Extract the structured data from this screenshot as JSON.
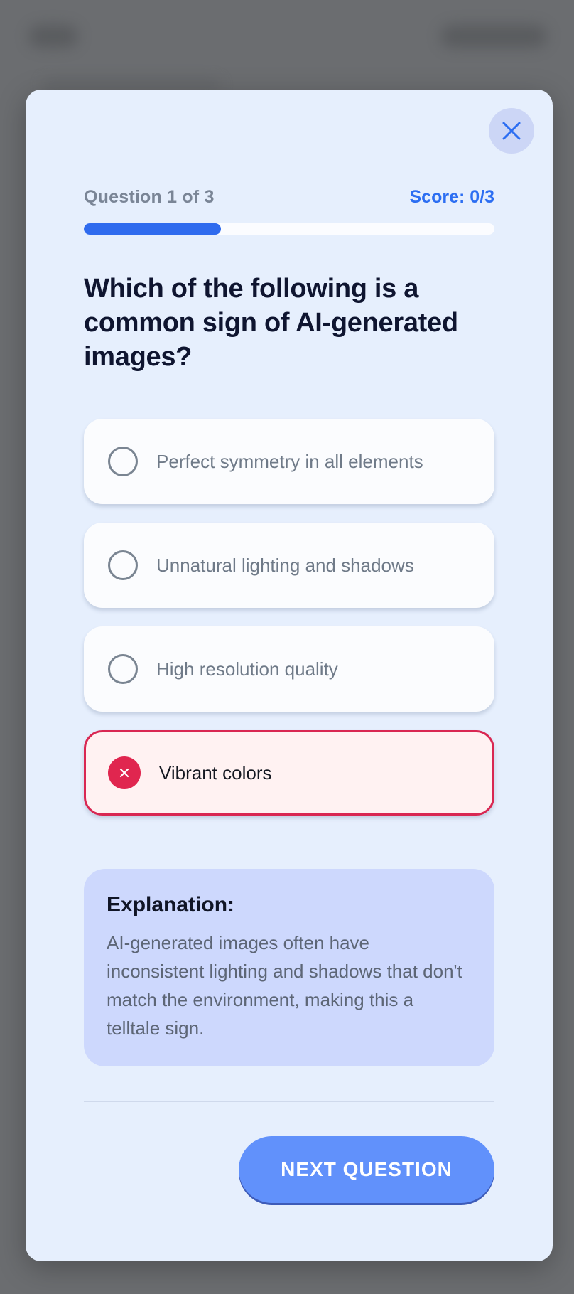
{
  "quiz": {
    "question_counter": "Question 1 of 3",
    "score_label": "Score: 0/3",
    "progress_fraction": 0.3333,
    "question": "Which of the following is a common sign of AI-generated images?",
    "options": [
      {
        "label": "Perfect symmetry in all elements",
        "state": "default"
      },
      {
        "label": "Unnatural lighting and shadows",
        "state": "default"
      },
      {
        "label": "High resolution quality",
        "state": "default"
      },
      {
        "label": "Vibrant colors",
        "state": "selected-wrong"
      }
    ],
    "explanation": {
      "title": "Explanation:",
      "body": "AI-generated images often have inconsistent lighting and shadows that don't match the environment, making this a telltale sign."
    },
    "next_button_label": "NEXT QUESTION"
  },
  "icons": {
    "close": "close-icon",
    "wrong_mark": "x-mark-icon",
    "radio": "radio-unchecked-icon"
  },
  "colors": {
    "accent": "#2f6bee",
    "error": "#e0264f",
    "button": "#6191fb",
    "modal_bg": "#e6effd",
    "explanation_bg": "#cdd8fd"
  }
}
